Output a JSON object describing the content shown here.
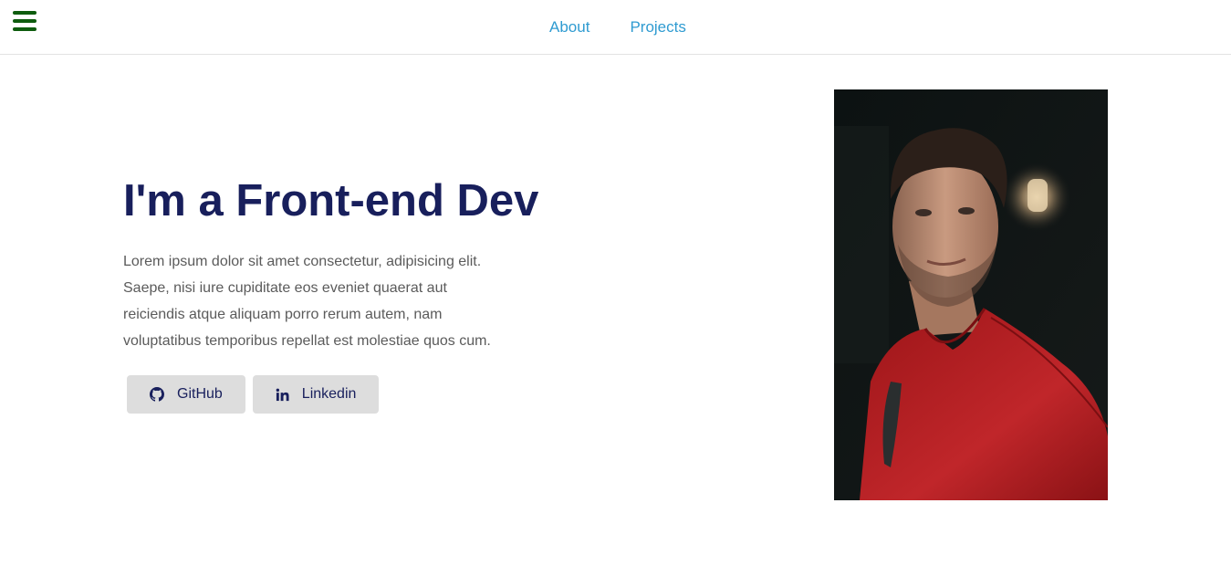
{
  "nav": {
    "menu_icon": "hamburger-menu-icon",
    "links": [
      {
        "label": "About"
      },
      {
        "label": "Projects"
      }
    ]
  },
  "hero": {
    "title": "I'm a Front-end Dev",
    "description": "Lorem ipsum dolor sit amet consectetur, adipisicing elit. Saepe, nisi iure cupiditate eos eveniet quaerat aut reiciendis atque aliquam porro rerum autem, nam voluptatibus temporibus repellat est molestiae quos cum.",
    "buttons": [
      {
        "label": "GitHub",
        "icon": "github-icon"
      },
      {
        "label": "Linkedin",
        "icon": "linkedin-icon"
      }
    ]
  },
  "colors": {
    "menu": "#0e5c0e",
    "nav_link": "#2f9bd1",
    "title": "#181f5c",
    "body_text": "#5b5b5b",
    "button_bg": "#dddddd"
  }
}
